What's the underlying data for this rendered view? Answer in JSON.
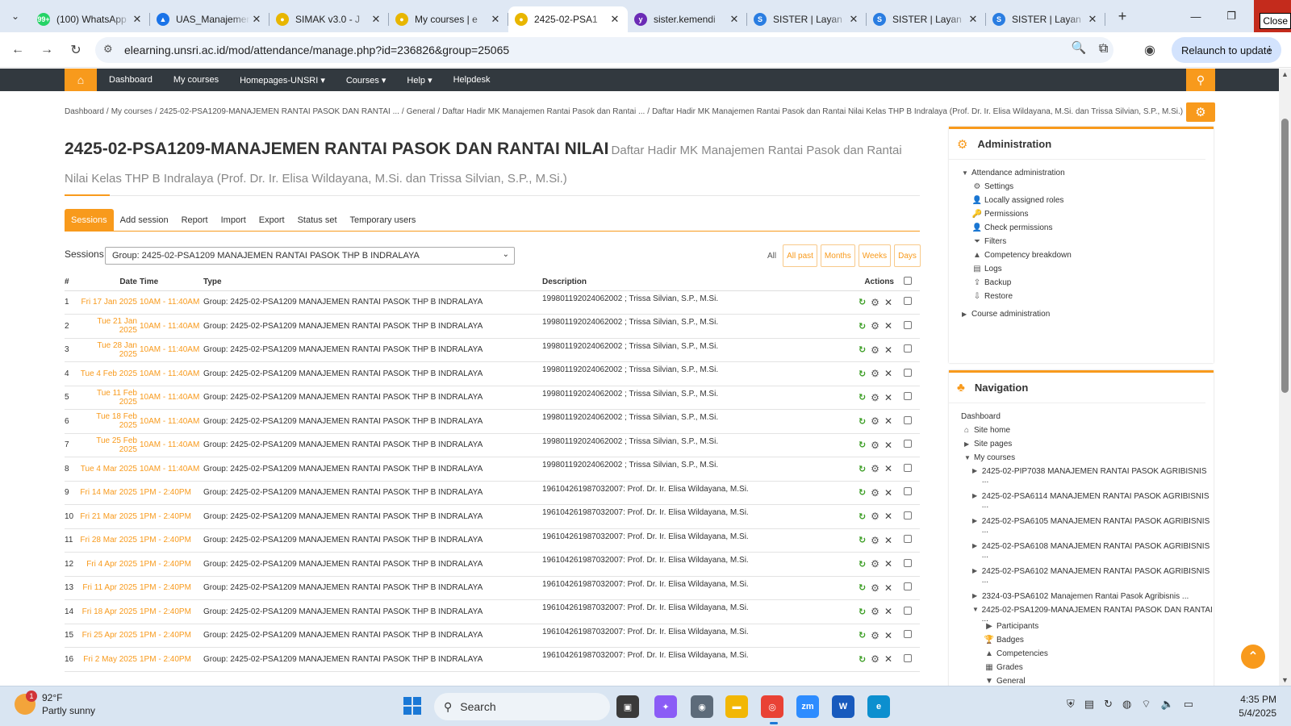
{
  "browser": {
    "tabs": [
      {
        "title": "(100) WhatsApp",
        "favicon_color": "#25d366",
        "favicon_glyph": "99+"
      },
      {
        "title": "UAS_Manajemen",
        "favicon_color": "#1a73e8",
        "favicon_glyph": "▲"
      },
      {
        "title": "SIMAK v3.0 - J",
        "favicon_color": "#e8b600",
        "favicon_glyph": "●"
      },
      {
        "title": "My courses | e",
        "favicon_color": "#e8b600",
        "favicon_glyph": "●"
      },
      {
        "title": "2425-02-PSA1",
        "favicon_color": "#e8b600",
        "favicon_glyph": "●",
        "active": true
      },
      {
        "title": "sister.kemendi",
        "favicon_color": "#6b2bb5",
        "favicon_glyph": "y"
      },
      {
        "title": "SISTER | Layan",
        "favicon_color": "#2a7de1",
        "favicon_glyph": "S"
      },
      {
        "title": "SISTER | Layan",
        "favicon_color": "#2a7de1",
        "favicon_glyph": "S"
      },
      {
        "title": "SISTER | Layan",
        "favicon_color": "#2a7de1",
        "favicon_glyph": "S"
      }
    ],
    "close_tooltip": "Close",
    "url": "elearning.unsri.ac.id/mod/attendance/manage.php?id=236826&group=25065",
    "relaunch_label": "Relaunch to update"
  },
  "site_nav": {
    "items": [
      "Dashboard",
      "My courses",
      "Homepages-UNSRI ▾",
      "Courses ▾",
      "Help ▾",
      "Helpdesk"
    ]
  },
  "breadcrumb": [
    "Dashboard",
    "/",
    "My courses",
    "/",
    "2425-02-PSA1209-MANAJEMEN RANTAI PASOK DAN RANTAI ...",
    "/",
    "General",
    "/",
    "Daftar Hadir MK Manajemen Rantai Pasok dan Rantai ...",
    "/",
    "Daftar Hadir MK Manajemen Rantai Pasok dan Rantai Nilai Kelas THP B Indralaya (Prof. Dr. Ir. Elisa Wildayana, M.Si. dan Trissa Silvian, S.P., M.Si.)"
  ],
  "page": {
    "course_title": "2425-02-PSA1209-MANAJEMEN RANTAI PASOK DAN RANTAI NILAI",
    "activity_title": "Daftar Hadir MK Manajemen Rantai Pasok dan Rantai Nilai Kelas THP B Indralaya (Prof. Dr. Ir. Elisa Wildayana, M.Si. dan Trissa Silvian, S.P., M.Si.)"
  },
  "attendance_tabs": [
    "Sessions",
    "Add session",
    "Report",
    "Import",
    "Export",
    "Status set",
    "Temporary users"
  ],
  "sessions_filter": {
    "label": "Sessions",
    "selected_group": "Group: 2425-02-PSA1209 MANAJEMEN RANTAI PASOK THP B INDRALAYA",
    "view_all": "All",
    "view_buttons": [
      "All past",
      "Months",
      "Weeks",
      "Days"
    ]
  },
  "table": {
    "headers": {
      "num": "#",
      "date": "Date",
      "time": "Time",
      "type": "Type",
      "description": "Description",
      "actions": "Actions"
    },
    "rows": [
      {
        "num": "1",
        "date": "Fri 17 Jan 2025",
        "time": "10AM - 11:40AM",
        "type": "Group: 2425-02-PSA1209 MANAJEMEN RANTAI PASOK THP B INDRALAYA",
        "description": "199801192024062002 ; Trissa Silvian, S.P., M.Si."
      },
      {
        "num": "2",
        "date": "Tue 21 Jan 2025",
        "time": "10AM - 11:40AM",
        "type": "Group: 2425-02-PSA1209 MANAJEMEN RANTAI PASOK THP B INDRALAYA",
        "description": "199801192024062002 ; Trissa Silvian, S.P., M.Si."
      },
      {
        "num": "3",
        "date": "Tue 28 Jan 2025",
        "time": "10AM - 11:40AM",
        "type": "Group: 2425-02-PSA1209 MANAJEMEN RANTAI PASOK THP B INDRALAYA",
        "description": "199801192024062002 ; Trissa Silvian, S.P., M.Si."
      },
      {
        "num": "4",
        "date": "Tue 4 Feb 2025",
        "time": "10AM - 11:40AM",
        "type": "Group: 2425-02-PSA1209 MANAJEMEN RANTAI PASOK THP B INDRALAYA",
        "description": "199801192024062002 ; Trissa Silvian, S.P., M.Si."
      },
      {
        "num": "5",
        "date": "Tue 11 Feb 2025",
        "time": "10AM - 11:40AM",
        "type": "Group: 2425-02-PSA1209 MANAJEMEN RANTAI PASOK THP B INDRALAYA",
        "description": "199801192024062002 ; Trissa Silvian, S.P., M.Si."
      },
      {
        "num": "6",
        "date": "Tue 18 Feb 2025",
        "time": "10AM - 11:40AM",
        "type": "Group: 2425-02-PSA1209 MANAJEMEN RANTAI PASOK THP B INDRALAYA",
        "description": "199801192024062002 ; Trissa Silvian, S.P., M.Si."
      },
      {
        "num": "7",
        "date": "Tue 25 Feb 2025",
        "time": "10AM - 11:40AM",
        "type": "Group: 2425-02-PSA1209 MANAJEMEN RANTAI PASOK THP B INDRALAYA",
        "description": "199801192024062002 ; Trissa Silvian, S.P., M.Si."
      },
      {
        "num": "8",
        "date": "Tue 4 Mar 2025",
        "time": "10AM - 11:40AM",
        "type": "Group: 2425-02-PSA1209 MANAJEMEN RANTAI PASOK THP B INDRALAYA",
        "description": "199801192024062002 ; Trissa Silvian, S.P., M.Si."
      },
      {
        "num": "9",
        "date": "Fri 14 Mar 2025",
        "time": "1PM - 2:40PM",
        "type": "Group: 2425-02-PSA1209 MANAJEMEN RANTAI PASOK THP B INDRALAYA",
        "description": "196104261987032007: Prof. Dr. Ir. Elisa Wildayana, M.Si."
      },
      {
        "num": "10",
        "date": "Fri 21 Mar 2025",
        "time": "1PM - 2:40PM",
        "type": "Group: 2425-02-PSA1209 MANAJEMEN RANTAI PASOK THP B INDRALAYA",
        "description": "196104261987032007: Prof. Dr. Ir. Elisa Wildayana, M.Si."
      },
      {
        "num": "11",
        "date": "Fri 28 Mar 2025",
        "time": "1PM - 2:40PM",
        "type": "Group: 2425-02-PSA1209 MANAJEMEN RANTAI PASOK THP B INDRALAYA",
        "description": "196104261987032007: Prof. Dr. Ir. Elisa Wildayana, M.Si."
      },
      {
        "num": "12",
        "date": "Fri 4 Apr 2025",
        "time": "1PM - 2:40PM",
        "type": "Group: 2425-02-PSA1209 MANAJEMEN RANTAI PASOK THP B INDRALAYA",
        "description": "196104261987032007: Prof. Dr. Ir. Elisa Wildayana, M.Si."
      },
      {
        "num": "13",
        "date": "Fri 11 Apr 2025",
        "time": "1PM - 2:40PM",
        "type": "Group: 2425-02-PSA1209 MANAJEMEN RANTAI PASOK THP B INDRALAYA",
        "description": "196104261987032007: Prof. Dr. Ir. Elisa Wildayana, M.Si."
      },
      {
        "num": "14",
        "date": "Fri 18 Apr 2025",
        "time": "1PM - 2:40PM",
        "type": "Group: 2425-02-PSA1209 MANAJEMEN RANTAI PASOK THP B INDRALAYA",
        "description": "196104261987032007: Prof. Dr. Ir. Elisa Wildayana, M.Si."
      },
      {
        "num": "15",
        "date": "Fri 25 Apr 2025",
        "time": "1PM - 2:40PM",
        "type": "Group: 2425-02-PSA1209 MANAJEMEN RANTAI PASOK THP B INDRALAYA",
        "description": "196104261987032007: Prof. Dr. Ir. Elisa Wildayana, M.Si."
      },
      {
        "num": "16",
        "date": "Fri 2 May 2025",
        "time": "1PM - 2:40PM",
        "type": "Group: 2425-02-PSA1209 MANAJEMEN RANTAI PASOK THP B INDRALAYA",
        "description": "196104261987032007: Prof. Dr. Ir. Elisa Wildayana, M.Si."
      }
    ]
  },
  "administration": {
    "title": "Administration",
    "section": "Attendance administration",
    "items": [
      {
        "label": "Settings",
        "icon": "gear-icon",
        "glyph": "⚙"
      },
      {
        "label": "Locally assigned roles",
        "icon": "user-icon",
        "glyph": "👤"
      },
      {
        "label": "Permissions",
        "icon": "key-icon",
        "glyph": "🔑"
      },
      {
        "label": "Check permissions",
        "icon": "user-check-icon",
        "glyph": "👤"
      },
      {
        "label": "Filters",
        "icon": "filter-icon",
        "glyph": "⏷"
      },
      {
        "label": "Competency breakdown",
        "icon": "competency-icon",
        "glyph": "▲"
      },
      {
        "label": "Logs",
        "icon": "logs-icon",
        "glyph": "▤"
      },
      {
        "label": "Backup",
        "icon": "backup-icon",
        "glyph": "⇪"
      },
      {
        "label": "Restore",
        "icon": "restore-icon",
        "glyph": "⇩"
      }
    ],
    "course_admin": "Course administration"
  },
  "navigation": {
    "title": "Navigation",
    "dashboard": "Dashboard",
    "site_home": "Site home",
    "site_pages": "Site pages",
    "my_courses": "My courses",
    "courses": [
      {
        "label": "2425-02-PIP7038 MANAJEMEN RANTAI PASOK AGRIBISNIS ...",
        "open": false
      },
      {
        "label": "2425-02-PSA6114 MANAJEMEN RANTAI PASOK AGRIBISNIS ...",
        "open": false
      },
      {
        "label": "2425-02-PSA6105 MANAJEMEN RANTAI PASOK AGRIBISNIS ...",
        "open": false
      },
      {
        "label": "2425-02-PSA6108 MANAJEMEN RANTAI PASOK AGRIBISNIS ...",
        "open": false
      },
      {
        "label": "2425-02-PSA6102 MANAJEMEN RANTAI PASOK AGRIBISNIS ...",
        "open": false
      },
      {
        "label": "2324-03-PSA6102 Manajemen Rantai Pasok Agribisnis ...",
        "open": false
      },
      {
        "label": "2425-02-PSA1209-MANAJEMEN RANTAI PASOK DAN RANTAI ...",
        "open": true
      }
    ],
    "current_course_items": [
      "Participants",
      "Badges",
      "Competencies",
      "Grades",
      "General"
    ]
  },
  "taskbar": {
    "weather_temp": "92°F",
    "weather_desc": "Partly sunny",
    "weather_badge": "1",
    "search_label": "Search",
    "time": "4:35 PM",
    "date": "5/4/2025"
  },
  "colors": {
    "accent": "#f89a1c",
    "navbar": "#32393f",
    "refresh_green": "#3a9d23"
  }
}
